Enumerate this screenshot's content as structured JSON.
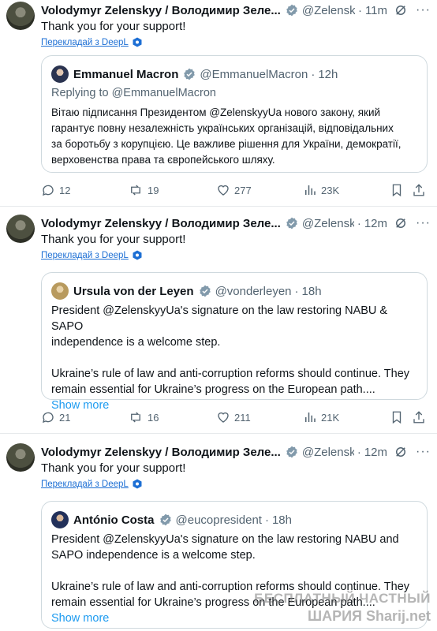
{
  "posts": [
    {
      "author": "Volodymyr Zelenskyy / Володимир Зеле...",
      "handle": "@Zelensky...",
      "time": "11m",
      "text": "Thank you for your support!",
      "translate": "Перекладай з DeepL",
      "quote": {
        "author": "Emmanuel Macron",
        "handle": "@EmmanuelMacron",
        "time": "12h",
        "replying": "Replying to @EmmanuelMacron",
        "lines": [
          "Вітаю підписання Президентом @ZelenskyyUa нового закону, який",
          "гарантує повну незалежність українських організацій, відповідальних",
          "за боротьбу з корупцією. Це важливе рішення для України, демократії,",
          "верховенства права та європейського шляху."
        ]
      },
      "stats": {
        "replies": "12",
        "reposts": "19",
        "likes": "277",
        "views": "23K"
      }
    },
    {
      "author": "Volodymyr Zelenskyy / Володимир Зеле...",
      "handle": "@Zelensky...",
      "time": "12m",
      "text": "Thank you for your support!",
      "translate": "Перекладай з DeepL",
      "quote": {
        "author": "Ursula von der Leyen",
        "handle": "@vonderleyen",
        "time": "18h",
        "lines": [
          "President @ZelenskyyUa's signature on the law restoring NABU & SAPO",
          "independence is a welcome step.",
          "",
          "Ukraine’s rule of law and anti-corruption reforms should continue. They",
          "remain essential for Ukraine’s progress on the European path...."
        ],
        "show_more": "Show more"
      },
      "stats": {
        "replies": "21",
        "reposts": "16",
        "likes": "211",
        "views": "21K"
      }
    },
    {
      "author": "Volodymyr Zelenskyy / Володимир Зеле...",
      "handle": "@Zelensky...",
      "time": "12m",
      "text": "Thank you for your support!",
      "translate": "Перекладай з DeepL",
      "quote": {
        "author": "António Costa",
        "handle": "@eucopresident",
        "time": "18h",
        "lines": [
          "President @ZelenskyyUa's signature on the law restoring NABU and",
          "SAPO independence is a welcome step.",
          "",
          "Ukraine’s rule of law and anti-corruption reforms should continue. They",
          "remain essential for Ukraine’s progress on the European path...."
        ],
        "show_more": "Show more"
      }
    }
  ],
  "watermark": {
    "line1": "БЕСПЛАТНЫЙ ЧАСТНЫЙ",
    "line2": "ШАРИЯ  Sharij.net"
  },
  "colors": {
    "link": "#1d9bf0",
    "verified": "#1d9bf0",
    "muted": "#536471",
    "border": "#cfd9de"
  }
}
